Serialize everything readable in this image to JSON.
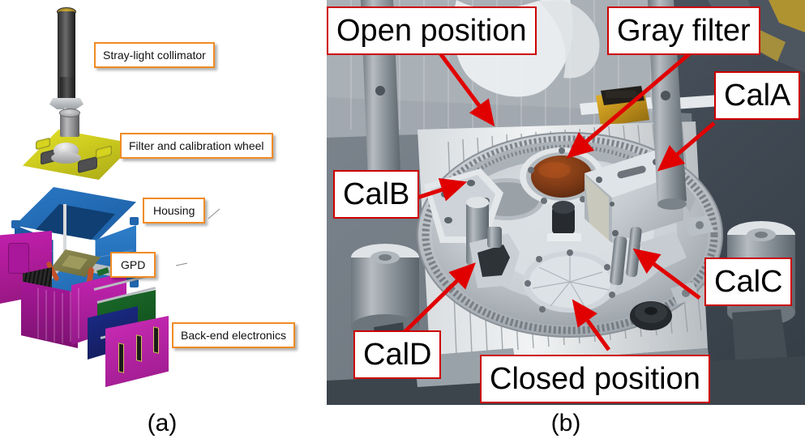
{
  "figure": {
    "panels": [
      {
        "id": "a",
        "caption": "(a)"
      },
      {
        "id": "b",
        "caption": "(b)"
      }
    ]
  },
  "panel_a": {
    "caption": "(a)",
    "description": "Exploded CAD view of instrument detector unit",
    "label_border_color": "#f08b24",
    "labels": [
      {
        "id": "stray-light-collimator",
        "text": "Stray-light collimator"
      },
      {
        "id": "filter-and-calibration-wheel",
        "text": "Filter and calibration wheel"
      },
      {
        "id": "housing",
        "text": "Housing"
      },
      {
        "id": "gpd",
        "text": "GPD"
      },
      {
        "id": "back-end-electronics",
        "text": "Back-end electronics"
      }
    ],
    "parts": {
      "collimator_color": "#3a3a3a",
      "wheel_color": "#d8d620",
      "housing_color": "#2a77c4",
      "gpd_color": "#8d8a52",
      "electronics_color": "#b5179e"
    }
  },
  "panel_b": {
    "caption": "(b)",
    "description": "Photograph of the filter and calibration wheel hardware",
    "label_border_color": "#cc0000",
    "arrow_color": "#e00000",
    "labels": [
      {
        "id": "open-position",
        "text": "Open position"
      },
      {
        "id": "gray-filter",
        "text": "Gray filter"
      },
      {
        "id": "cal-a",
        "text": "CalA"
      },
      {
        "id": "cal-b",
        "text": "CalB"
      },
      {
        "id": "cal-c",
        "text": "CalC"
      },
      {
        "id": "cal-d",
        "text": "CalD"
      },
      {
        "id": "closed-position",
        "text": "Closed position"
      }
    ]
  }
}
